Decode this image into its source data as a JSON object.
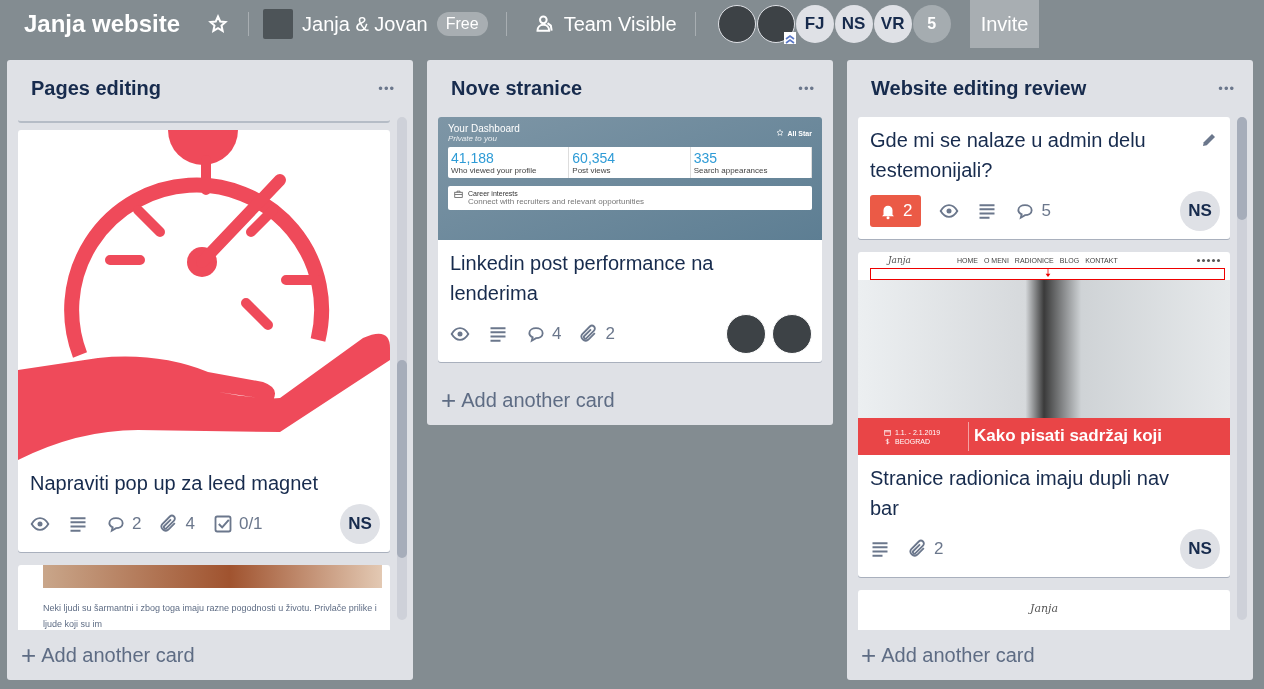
{
  "board": {
    "title": "Janja website",
    "team": {
      "name": "Janja & Jovan",
      "plan": "Free"
    },
    "visibility": "Team Visible",
    "members": [
      {
        "kind": "photo",
        "admin": false
      },
      {
        "kind": "photo",
        "admin": true
      },
      {
        "kind": "initials",
        "initials": "FJ",
        "admin": false
      },
      {
        "kind": "initials",
        "initials": "NS",
        "admin": false
      },
      {
        "kind": "initials",
        "initials": "VR",
        "admin": false
      }
    ],
    "more_members": "5",
    "invite_button": "Invite"
  },
  "lists": [
    {
      "title": "Pages editing",
      "menu": "•••",
      "scrollbar": true,
      "add_card": "Add another card",
      "add_icon": "+",
      "cards": [
        {
          "cover": {
            "kind": "icon"
          },
          "title": "Napraviti pop up za leed magnet",
          "hovered": false,
          "badges": [
            {
              "kind": "watch"
            },
            {
              "kind": "description"
            },
            {
              "kind": "comments",
              "count": "2"
            },
            {
              "kind": "attachments",
              "count": "4"
            },
            {
              "kind": "checklist",
              "count": "0/1"
            }
          ],
          "members": [
            {
              "kind": "initials",
              "initials": "NS"
            }
          ]
        },
        {
          "cover": {
            "kind": "article",
            "text": "Neki ljudi su šarmantni i zbog toga imaju razne pogodnosti u životu. Privlače prilike i ljude koji su im"
          }
        }
      ]
    },
    {
      "title": "Nove stranice",
      "menu": "•••",
      "scrollbar": false,
      "add_card": "Add another card",
      "add_icon": "+",
      "cards": [
        {
          "cover": {
            "kind": "dashboard",
            "heading": "Your Dashboard",
            "subheading": "Private to you",
            "rank": "All Star",
            "stats": [
              {
                "value": "41,188",
                "label": "Who viewed your profile"
              },
              {
                "value": "60,354",
                "label": "Post views"
              },
              {
                "value": "335",
                "label": "Search appearances"
              }
            ],
            "section_title": "Career interests",
            "section_text": "Connect with recruiters and relevant opportunities"
          },
          "title": "Linkedin post performance na lenderima",
          "hovered": false,
          "badges": [
            {
              "kind": "watch"
            },
            {
              "kind": "description"
            },
            {
              "kind": "comments",
              "count": "4"
            },
            {
              "kind": "attachments",
              "count": "2"
            }
          ],
          "members": [
            {
              "kind": "photo"
            },
            {
              "kind": "photo"
            }
          ]
        }
      ]
    },
    {
      "title": "Website editing review",
      "menu": "•••",
      "scrollbar": true,
      "add_card": "Add another card",
      "add_icon": "+",
      "cards": [
        {
          "title": "Gde mi se nalaze u admin delu testemonijali?",
          "hovered": true,
          "badges": [
            {
              "kind": "notifications",
              "count": "2"
            },
            {
              "kind": "watch"
            },
            {
              "kind": "description"
            },
            {
              "kind": "comments",
              "count": "5"
            }
          ],
          "members": [
            {
              "kind": "initials",
              "initials": "NS"
            }
          ]
        },
        {
          "cover": {
            "kind": "website",
            "logo": "Janja",
            "nav": [
              "HOME",
              "O MENI",
              "RADIONICE",
              "BLOG",
              "KONTAKT"
            ],
            "date": "1.1. - 2.1.2019",
            "place": "BEOGRAD",
            "headline": "Kako pisati sadržaj koji"
          },
          "title": "Stranice radionica imaju dupli nav bar",
          "hovered": false,
          "badges": [
            {
              "kind": "description"
            },
            {
              "kind": "attachments",
              "count": "2"
            }
          ],
          "members": [
            {
              "kind": "initials",
              "initials": "NS"
            }
          ]
        },
        {
          "cover": {
            "kind": "logo",
            "logo": "Janja"
          }
        }
      ]
    }
  ]
}
